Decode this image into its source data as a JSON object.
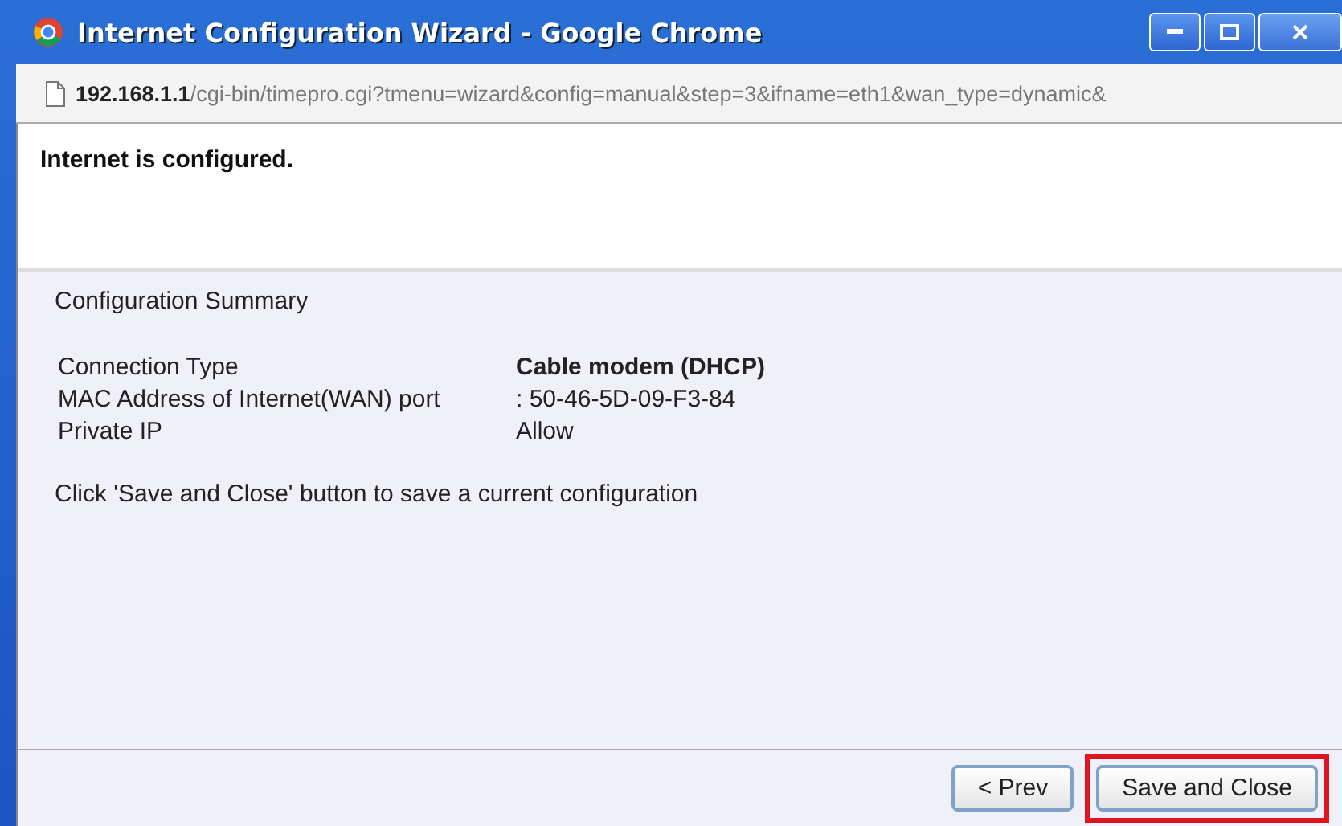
{
  "window": {
    "title": "Internet Configuration Wizard - Google Chrome"
  },
  "address_bar": {
    "host": "192.168.1.1",
    "path": "/cgi-bin/timepro.cgi?tmenu=wizard&config=manual&step=3&ifname=eth1&wan_type=dynamic&"
  },
  "header": {
    "message": "Internet is configured."
  },
  "summary": {
    "title": "Configuration Summary",
    "rows": [
      {
        "label": "Connection Type",
        "value": "Cable modem (DHCP)",
        "emphasis": true
      },
      {
        "label": "MAC Address of Internet(WAN) port",
        "value": ": 50-46-5D-09-F3-84",
        "emphasis": false
      },
      {
        "label": "Private IP",
        "value": "Allow",
        "emphasis": false
      }
    ],
    "note": "Click 'Save and Close' button to save a current configuration"
  },
  "buttons": [
    {
      "label": "< Prev",
      "highlighted": false
    },
    {
      "label": "Save and Close",
      "highlighted": true
    }
  ]
}
